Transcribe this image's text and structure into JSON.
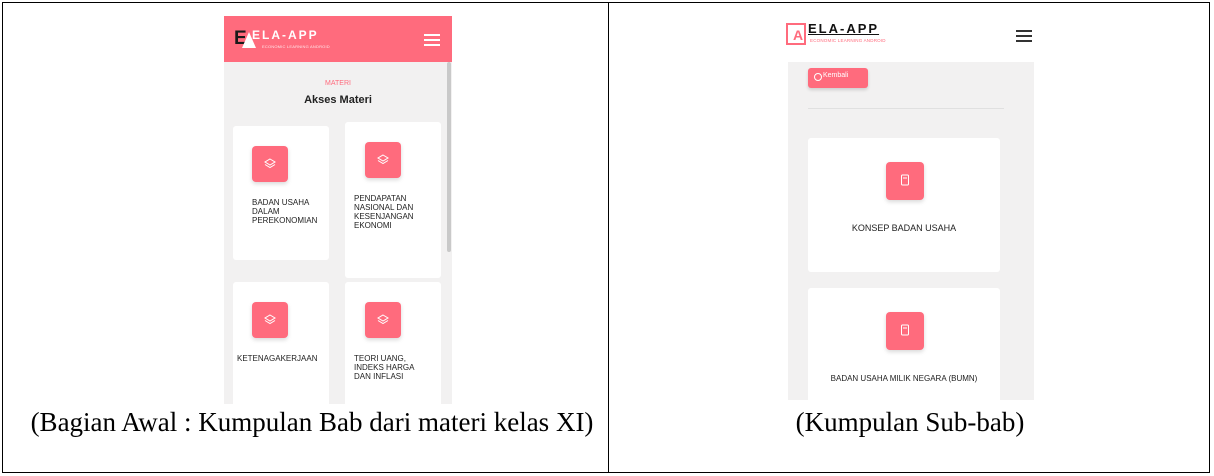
{
  "left_screen": {
    "app_title": "ELA-APP",
    "app_subtitle": "ECONOMIC LEARNING ANDROID",
    "section_kicker": "MATERI",
    "section_title": "Akses Materi",
    "cards": [
      {
        "label": "BADAN USAHA DALAM PEREKONOMIAN",
        "icon": "layers-icon"
      },
      {
        "label": "PENDAPATAN NASIONAL DAN KESENJANGAN EKONOMI",
        "icon": "layers-icon"
      },
      {
        "label": "KETENAGAKERJAAN",
        "icon": "layers-icon"
      },
      {
        "label": "TEORI UANG, INDEKS HARGA DAN INFLASI",
        "icon": "layers-icon"
      }
    ]
  },
  "right_screen": {
    "app_title": "ELA-APP",
    "app_subtitle": "ECONOMIC LEARNING ANDROID",
    "back_button": "Kembali",
    "cards": [
      {
        "label": "KONSEP BADAN USAHA",
        "icon": "book-icon"
      },
      {
        "label": "BADAN USAHA MILIK NEGARA (BUMN)",
        "icon": "book-icon"
      }
    ]
  },
  "captions": {
    "left": "(Bagian Awal : Kumpulan Bab dari materi kelas XI)",
    "right": "(Kumpulan Sub-bab)"
  },
  "colors": {
    "accent": "#ff6b7d",
    "background": "#f2f1f1",
    "card": "#ffffff"
  }
}
